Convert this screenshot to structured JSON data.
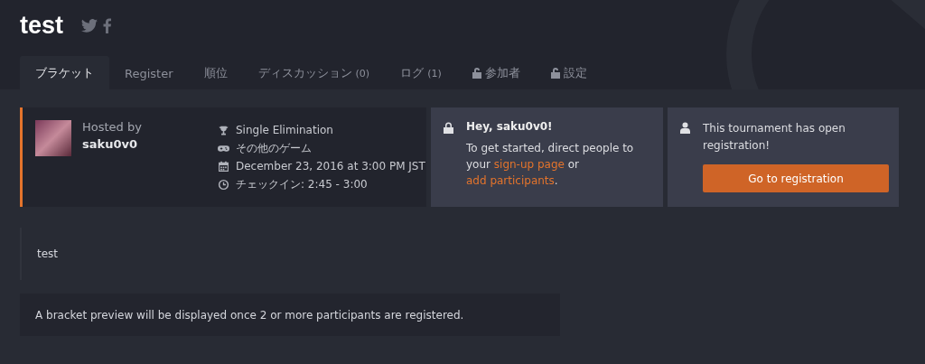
{
  "header": {
    "title": "test"
  },
  "tabs": [
    {
      "label": "ブラケット",
      "selected": true,
      "locked": false
    },
    {
      "label": "Register",
      "selected": false,
      "locked": false
    },
    {
      "label": "順位",
      "selected": false,
      "locked": false
    },
    {
      "label": "ディスカッション",
      "count": "(0)",
      "selected": false,
      "locked": false
    },
    {
      "label": "ログ",
      "count": "(1)",
      "selected": false,
      "locked": false
    },
    {
      "label": "参加者",
      "selected": false,
      "locked": true
    },
    {
      "label": "設定",
      "selected": false,
      "locked": true
    }
  ],
  "host_card": {
    "hosted_by_label": "Hosted by",
    "host": "saku0v0",
    "details": [
      {
        "kind": "trophy",
        "text": "Single Elimination"
      },
      {
        "kind": "gamepad",
        "text": "その他のゲーム"
      },
      {
        "kind": "calendar",
        "text": "December 23, 2016 at 3:00 PM JST"
      },
      {
        "kind": "clock",
        "text": "チェックイン: 2:45 - 3:00"
      }
    ]
  },
  "welcome_card": {
    "heading": "Hey, saku0v0!",
    "segments": [
      {
        "kind": "text",
        "text": "To get started, direct people to your "
      },
      {
        "kind": "link",
        "text": "sign-up page"
      },
      {
        "kind": "text",
        "text": " or "
      },
      {
        "kind": "link",
        "text": "add participants"
      },
      {
        "kind": "text",
        "text": "."
      }
    ]
  },
  "registration_card": {
    "message": "This tournament has open registration!",
    "button": "Go to registration"
  },
  "description": "test",
  "bracket_notice": "A bracket preview will be displayed once 2 or more participants are registered."
}
